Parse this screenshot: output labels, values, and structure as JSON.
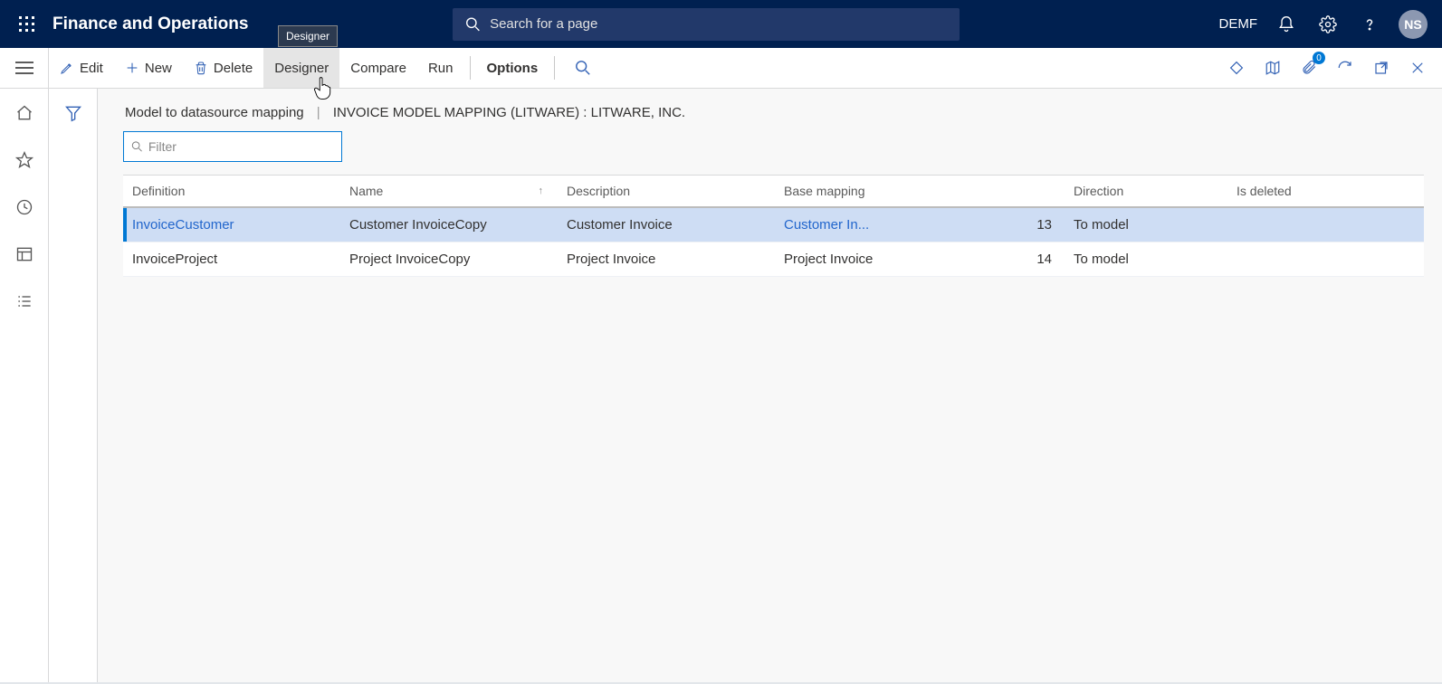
{
  "header": {
    "app_title": "Finance and Operations",
    "search_placeholder": "Search for a page",
    "company": "DEMF",
    "avatar_initials": "NS",
    "tooltip": "Designer"
  },
  "actions": {
    "edit": "Edit",
    "new": "New",
    "delete": "Delete",
    "designer": "Designer",
    "compare": "Compare",
    "run": "Run",
    "options": "Options",
    "attach_badge": "0"
  },
  "breadcrumb": {
    "part1": "Model to datasource mapping",
    "part2": "INVOICE MODEL MAPPING (LITWARE) : LITWARE, INC."
  },
  "filter": {
    "placeholder": "Filter"
  },
  "columns": {
    "definition": "Definition",
    "name": "Name",
    "description": "Description",
    "base_mapping": "Base mapping",
    "direction": "Direction",
    "is_deleted": "Is deleted"
  },
  "rows": [
    {
      "definition": "InvoiceCustomer",
      "name": "Customer InvoiceCopy",
      "description": "Customer Invoice",
      "base_mapping": "Customer In...",
      "num": "13",
      "direction": "To model",
      "selected": true,
      "base_link": true
    },
    {
      "definition": "InvoiceProject",
      "name": "Project InvoiceCopy",
      "description": "Project Invoice",
      "base_mapping": "Project Invoice",
      "num": "14",
      "direction": "To model",
      "selected": false,
      "base_link": false
    }
  ]
}
